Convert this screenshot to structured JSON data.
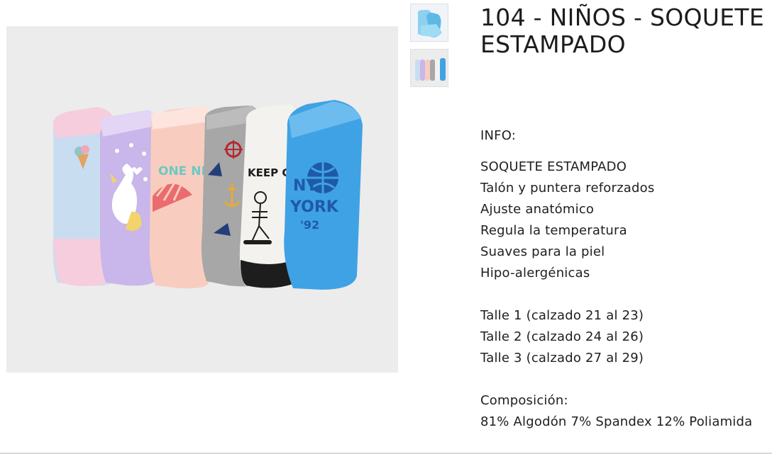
{
  "product": {
    "title": "104 - NIÑOS - SOQUETE ESTAMPADO"
  },
  "info": {
    "heading": "INFO:",
    "name": "SOQUETE ESTAMPADO",
    "features": [
      "Talón y puntera reforzados",
      "Ajuste anatómico",
      "Regula la temperatura",
      "Suaves para la piel",
      "Hipo-alergénicas"
    ],
    "sizes": [
      "Talle 1 (calzado 21 al 23)",
      "Talle 2 (calzado 24 al 26)",
      "Talle 3 (calzado 27 al 29)"
    ],
    "composition_label": "Composición:",
    "composition": "81% Algodón 7% Spandex 12% Poliamida"
  },
  "socks_art": {
    "sock_3": "ONE NIGHT",
    "sock_5": "KEEP CALLING!",
    "sock_6_top": "NY",
    "sock_6_mid": "YORK",
    "sock_6_year": "'92"
  },
  "colors": {
    "image_bg": "#ececec",
    "sock_blue_light": "#c9ddf0",
    "sock_lilac": "#c9b6ea",
    "sock_peach": "#f8cdbf",
    "sock_grey": "#a7a7a7",
    "sock_white": "#f4f2ee",
    "sock_blue": "#3fa2e4",
    "toe_pink": "#f6cddd"
  }
}
